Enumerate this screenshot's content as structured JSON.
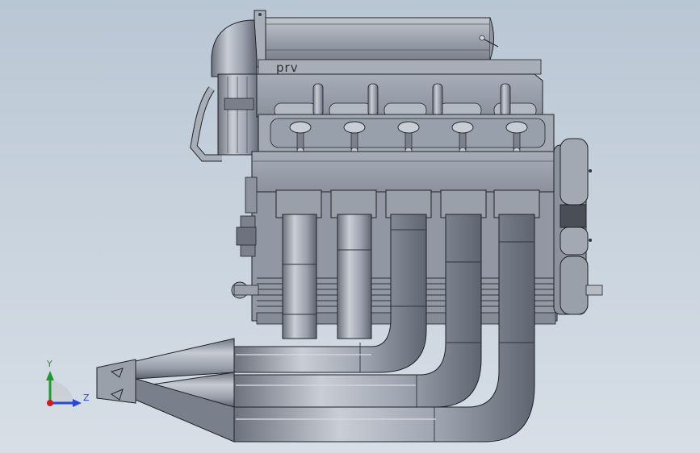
{
  "model": {
    "manifold_label": "prv"
  },
  "triad": {
    "y_label": "Y",
    "z_label": "Z",
    "y_color": "#1f9a2e",
    "z_color": "#2a47d6",
    "x_color": "#d11a1a"
  },
  "colors": {
    "background_top": "#b9c6d3",
    "background_bottom": "#d7dee6",
    "metal": "#9aa1ad",
    "metal_light": "#c4c9d2",
    "metal_dark": "#6c727d",
    "edge": "#1e2228"
  }
}
